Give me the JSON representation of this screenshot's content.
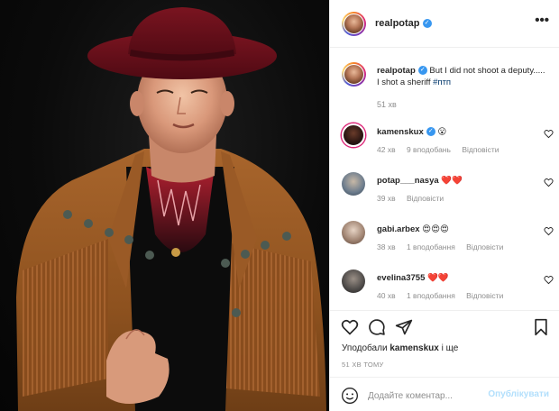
{
  "post": {
    "author": "realpotap",
    "photo_alt_icon": "photo-of-man-in-hat"
  },
  "caption": {
    "username": "realpotap",
    "text": "But I did not shoot a deputy..... I shot a sheriff ",
    "hashtag": "#птп",
    "time": "51 хв"
  },
  "comments": [
    {
      "username": "kamenskux",
      "verified": true,
      "text": "😮",
      "time": "42 хв",
      "likes": "9 вподобань",
      "reply": "Відповісти"
    },
    {
      "username": "potap___nasya",
      "verified": false,
      "text": "❤️❤️",
      "time": "39 хв",
      "likes": "",
      "reply": "Відповісти"
    },
    {
      "username": "gabi.arbex",
      "verified": false,
      "text": "😍😍😍",
      "time": "38 хв",
      "likes": "1 вподобання",
      "reply": "Відповісти"
    },
    {
      "username": "evelina3755",
      "verified": false,
      "text": "❤️❤️",
      "time": "40 хв",
      "likes": "1 вподобання",
      "reply": "Відповісти"
    }
  ],
  "actions": {
    "liked_prefix": "Уподобали ",
    "liked_user": "kamenskux",
    "liked_suffix": " і ще",
    "post_time": "51 хв тому"
  },
  "add_comment": {
    "placeholder": "Додайте коментар...",
    "publish": "Опублікувати"
  },
  "colors": {
    "verified": "#3897f0",
    "link": "#00376b",
    "publish_disabled": "#b2dffc",
    "heart_red": "#ed4956"
  }
}
